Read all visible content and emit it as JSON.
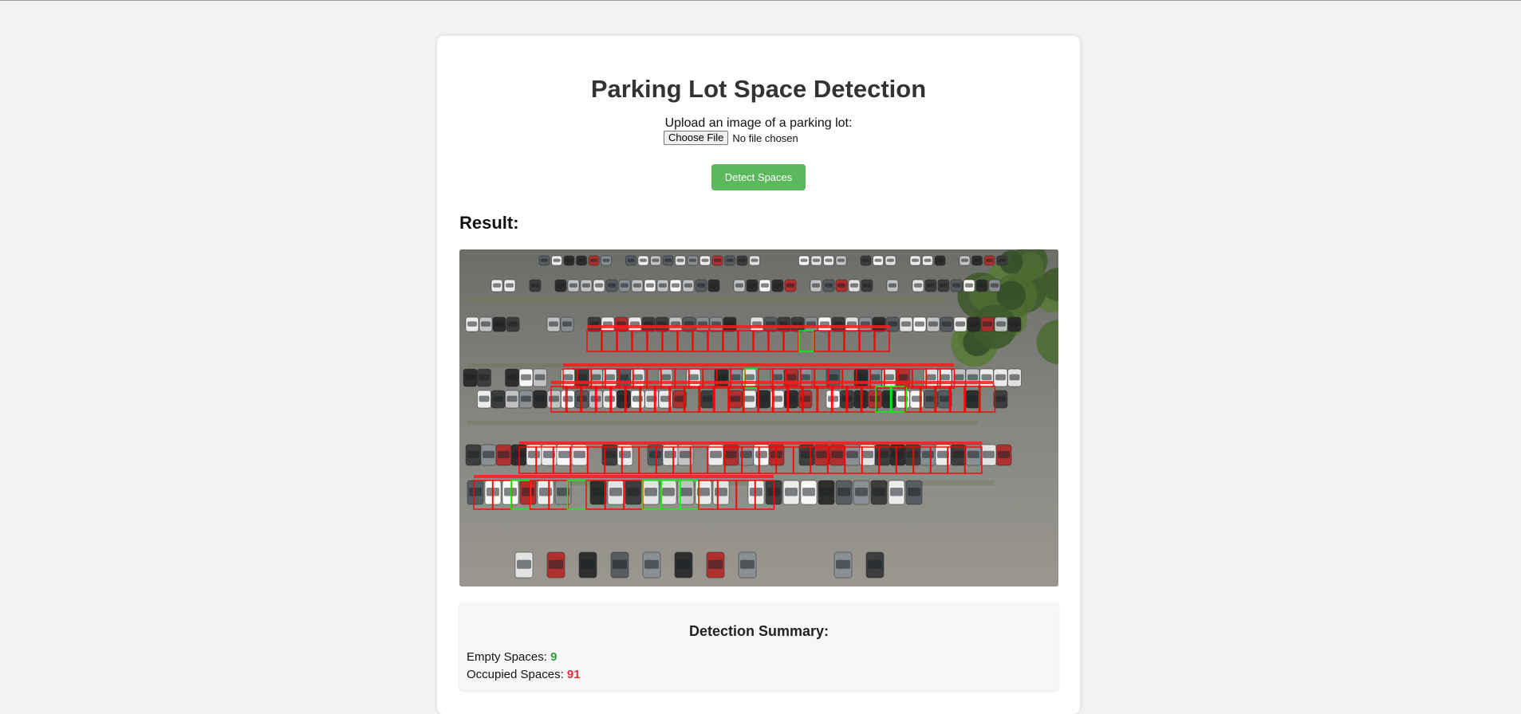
{
  "page": {
    "title": "Parking Lot Space Detection",
    "upload_label": "Upload an image of a parking lot:",
    "file_button": "Choose File",
    "file_status": "No file chosen",
    "detect_button": "Detect Spaces",
    "result_heading": "Result:"
  },
  "summary": {
    "title": "Detection Summary:",
    "empty_label": "Empty Spaces:",
    "empty_value": "9",
    "occupied_label": "Occupied Spaces:",
    "occupied_value": "91"
  },
  "colors": {
    "page_background": "#f2f2f2",
    "detect_button": "#5cb85c",
    "empty_box": "#00ff00",
    "occupied_box": "#ff0000",
    "empty_value": "#2e9e3e",
    "occupied_value": "#d9333f"
  }
}
